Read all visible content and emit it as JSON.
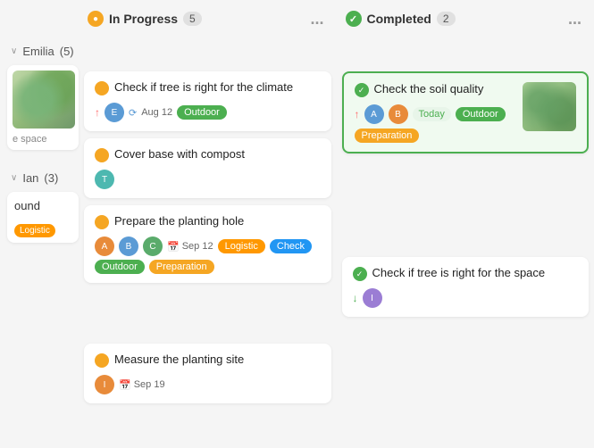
{
  "columns": {
    "left": {
      "label": ""
    },
    "inProgress": {
      "label": "In Progress",
      "count": 5,
      "dots": "..."
    },
    "completed": {
      "label": "Completed",
      "count": 2,
      "dots": "..."
    }
  },
  "groups": {
    "emilia": {
      "name": "Emilia",
      "count": 5,
      "cards_left": {
        "image_alt": "plant"
      },
      "cards_middle": [
        {
          "id": "c1",
          "title": "Check if tree is right for the climate",
          "status": "yellow",
          "arrow": "↑",
          "sync": "⟳",
          "date": "Aug 12",
          "tags": [
            "Outdoor"
          ]
        },
        {
          "id": "c2",
          "title": "Cover base with compost",
          "status": "yellow"
        },
        {
          "id": "c3",
          "title": "Prepare the planting hole",
          "status": "yellow",
          "date": "Sep 12",
          "tags": [
            "Logistic",
            "Check",
            "Outdoor",
            "Preparation"
          ]
        }
      ],
      "cards_right": [
        {
          "id": "cr1",
          "title": "Check the soil quality",
          "status": "green",
          "arrow": "↑",
          "date_label": "Today",
          "tags": [
            "Outdoor",
            "Preparation"
          ],
          "has_image": true
        }
      ]
    },
    "ian": {
      "name": "Ian",
      "count": 3,
      "cards_left": {
        "tag": "Logistic"
      },
      "cards_middle": [
        {
          "id": "im1",
          "title": "Measure the planting site",
          "status": "yellow",
          "date": "Sep 19"
        }
      ],
      "cards_right": [
        {
          "id": "ir1",
          "title": "Check if tree is right for the space",
          "status": "green",
          "arrow": "↓"
        }
      ]
    }
  },
  "icons": {
    "check": "✓",
    "dots": "···",
    "chevron_down": "∨",
    "calendar": "📅",
    "sync": "⟳"
  },
  "tags": {
    "outdoor": "Outdoor",
    "preparation": "Preparation",
    "logistic": "Logistic",
    "check": "Check",
    "today": "Today"
  }
}
